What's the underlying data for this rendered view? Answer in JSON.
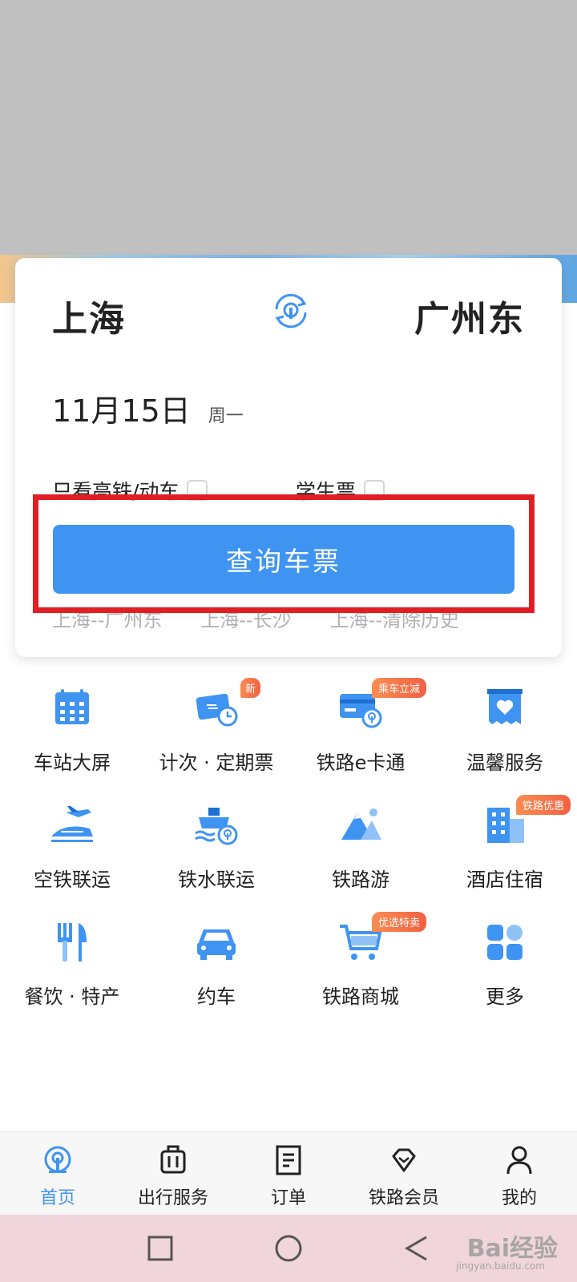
{
  "search": {
    "from_city": "上海",
    "to_city": "广州东",
    "date": "11月15日",
    "weekday": "周一",
    "option_highspeed": "只看高铁/动车",
    "option_student": "学生票",
    "query_button": "查询车票",
    "history": [
      "上海--广州东",
      "上海--长沙",
      "上海--清除历史"
    ]
  },
  "services": [
    {
      "label": "车站大屏",
      "icon": "calendar-grid-icon"
    },
    {
      "label": "计次 · 定期票",
      "icon": "ticket-clock-icon",
      "badge": "新"
    },
    {
      "label": "铁路e卡通",
      "icon": "card-train-icon",
      "badge": "乘车立减"
    },
    {
      "label": "温馨服务",
      "icon": "heart-box-icon"
    },
    {
      "label": "空铁联运",
      "icon": "plane-train-icon"
    },
    {
      "label": "铁水联运",
      "icon": "ship-train-icon"
    },
    {
      "label": "铁路游",
      "icon": "mountain-icon"
    },
    {
      "label": "酒店住宿",
      "icon": "hotel-icon",
      "badge": "铁路优惠"
    },
    {
      "label": "餐饮 · 特产",
      "icon": "fork-knife-icon"
    },
    {
      "label": "约车",
      "icon": "car-icon"
    },
    {
      "label": "铁路商城",
      "icon": "cart-icon",
      "badge": "优选特卖"
    },
    {
      "label": "更多",
      "icon": "grid-more-icon"
    }
  ],
  "tabs": [
    {
      "label": "首页",
      "icon": "train-logo-icon",
      "active": true
    },
    {
      "label": "出行服务",
      "icon": "luggage-icon"
    },
    {
      "label": "订单",
      "icon": "order-doc-icon"
    },
    {
      "label": "铁路会员",
      "icon": "diamond-icon"
    },
    {
      "label": "我的",
      "icon": "user-icon"
    }
  ],
  "watermark": {
    "text": "Bai经验",
    "sub": "jingyan.baidu.com"
  },
  "colors": {
    "accent": "#3f94f2",
    "highlight_frame": "#e01e24",
    "badge": "#f26143"
  }
}
